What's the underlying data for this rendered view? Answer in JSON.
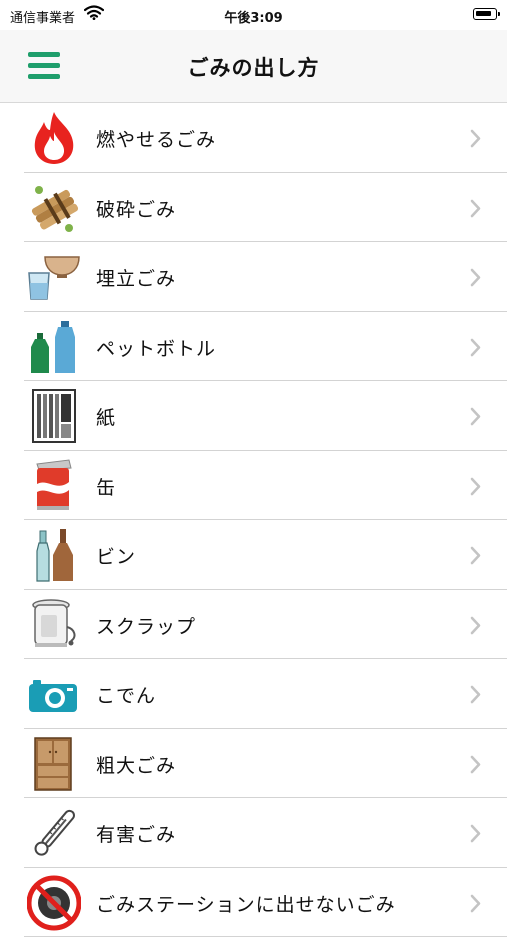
{
  "status_bar": {
    "carrier": "通信事業者",
    "time": "午後3:09"
  },
  "nav": {
    "title": "ごみの出し方"
  },
  "items": [
    {
      "label": "燃やせるごみ",
      "icon": "fire-icon"
    },
    {
      "label": "破砕ごみ",
      "icon": "firewood-bundle-icon"
    },
    {
      "label": "埋立ごみ",
      "icon": "bowl-and-glass-icon"
    },
    {
      "label": "ペットボトル",
      "icon": "pet-bottles-icon"
    },
    {
      "label": "紙",
      "icon": "newspaper-icon"
    },
    {
      "label": "缶",
      "icon": "can-icon"
    },
    {
      "label": "ビン",
      "icon": "glass-bottles-icon"
    },
    {
      "label": "スクラップ",
      "icon": "electric-pot-icon"
    },
    {
      "label": "こでん",
      "icon": "camera-icon"
    },
    {
      "label": "粗大ごみ",
      "icon": "cabinet-icon"
    },
    {
      "label": "有害ごみ",
      "icon": "thermometer-icon"
    },
    {
      "label": "ごみステーションに出せないごみ",
      "icon": "prohibited-tire-icon"
    }
  ],
  "colors": {
    "accent": "#1e9e6b",
    "chevron": "#c4c4c4"
  }
}
